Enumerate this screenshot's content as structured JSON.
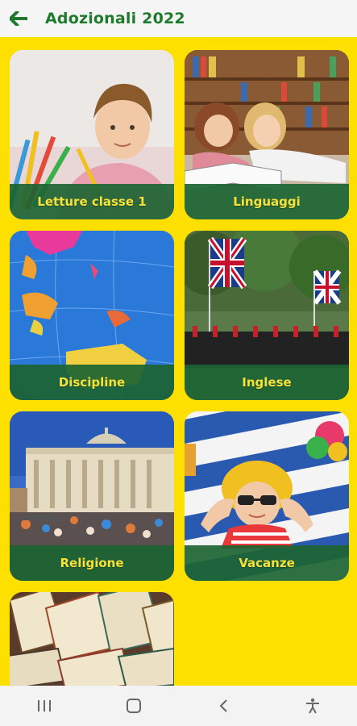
{
  "header": {
    "title": "Adozionali 2022",
    "back_icon": "arrow-left-icon"
  },
  "tiles": [
    {
      "label": "Letture classe 1",
      "image": "boy-with-pencils"
    },
    {
      "label": "Linguaggi",
      "image": "girls-reading-book"
    },
    {
      "label": "Discipline",
      "image": "globe"
    },
    {
      "label": "Inglese",
      "image": "british-guards-flags"
    },
    {
      "label": "Religione",
      "image": "st-peters-basilica"
    },
    {
      "label": "Vacanze",
      "image": "child-with-sunglasses"
    },
    {
      "label": "",
      "image": "stack-of-books"
    }
  ],
  "navbar": {
    "recents_icon": "recents-icon",
    "home_icon": "home-icon",
    "back_icon": "back-chevron-icon",
    "accessibility_icon": "accessibility-icon"
  },
  "colors": {
    "background": "#fde000",
    "header_text": "#1e7a2c",
    "label_bar": "#1c6432",
    "label_text": "#f6e23a"
  }
}
